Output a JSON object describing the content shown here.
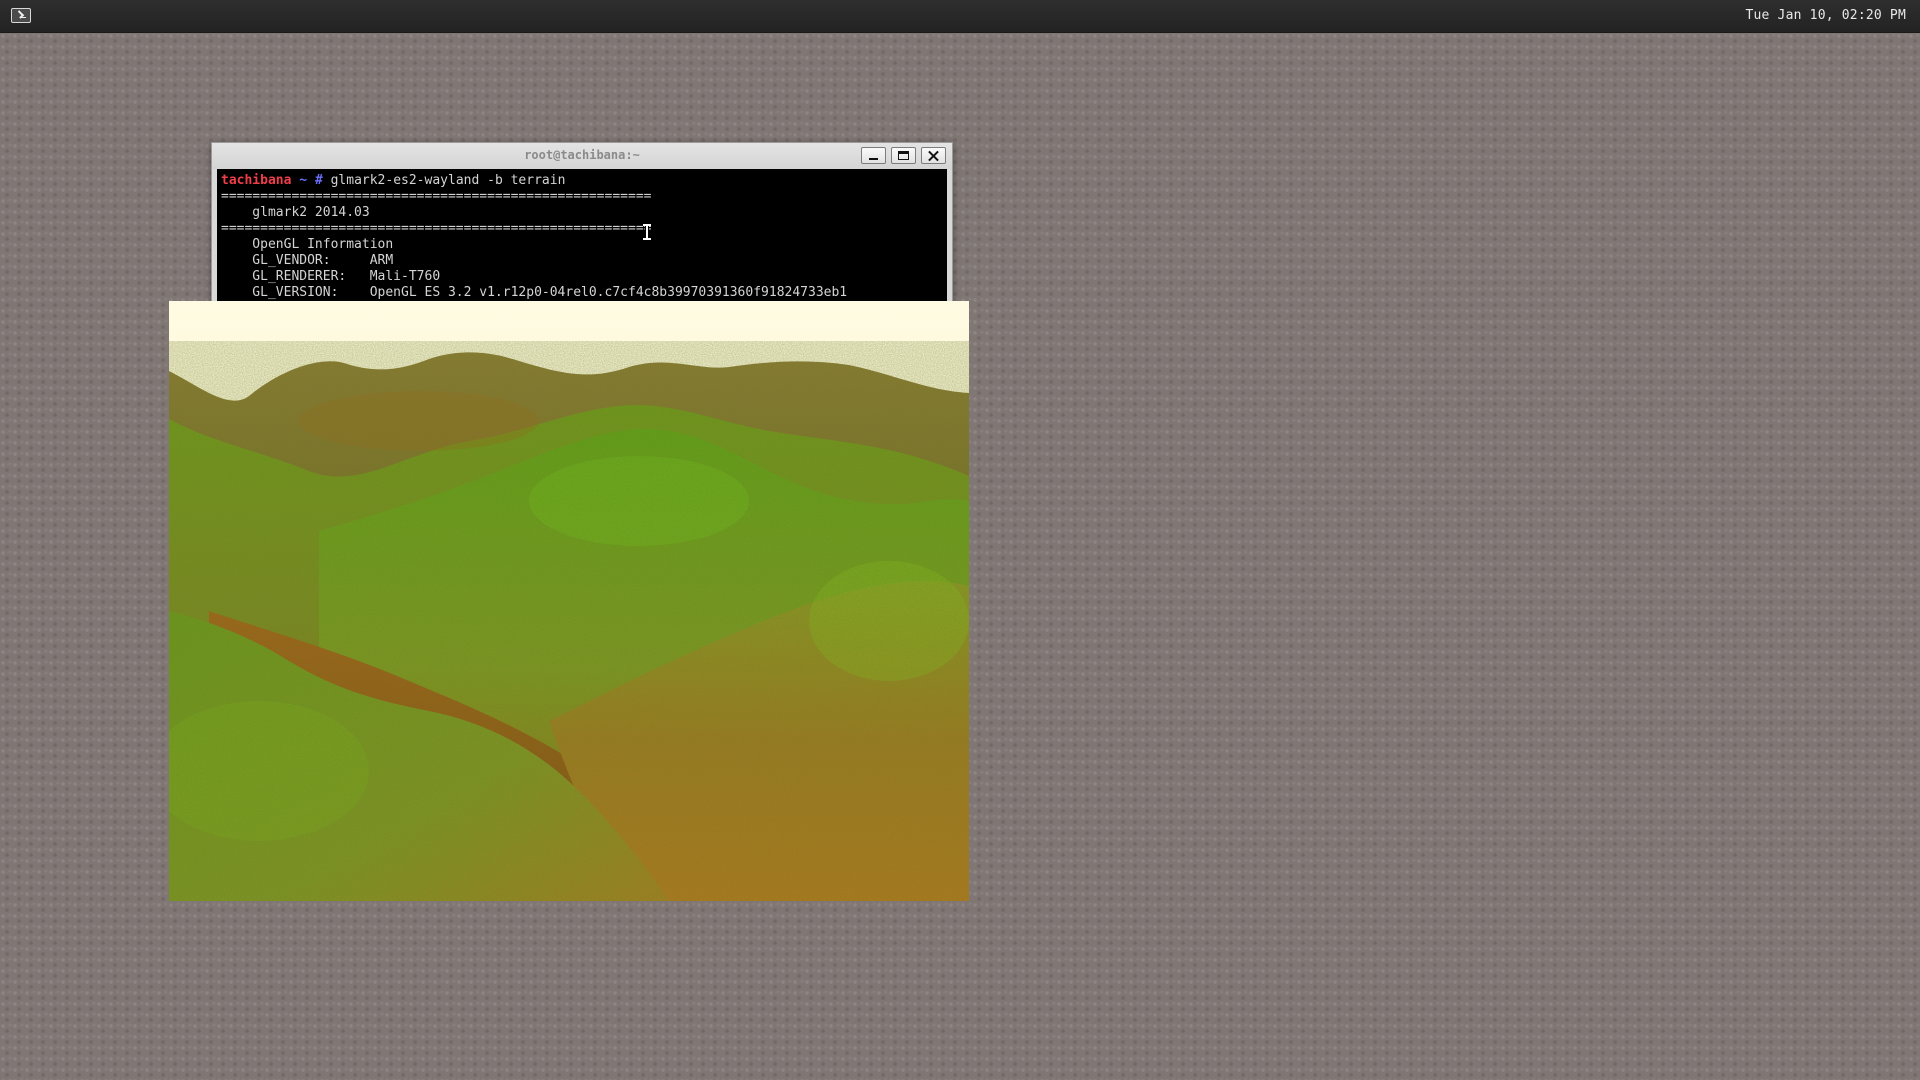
{
  "panel": {
    "launcher_icon": "terminal-icon",
    "clock": "Tue Jan 10, 02:20 PM"
  },
  "terminal": {
    "title": "root@tachibana:~",
    "buttons": {
      "minimize_icon": "minimize-icon",
      "maximize_icon": "maximize-icon",
      "close_icon": "close-icon"
    },
    "prompt": {
      "host": "tachibana",
      "path": "~",
      "symbol": "#",
      "command": "glmark2-es2-wayland -b terrain"
    },
    "lines": [
      "=======================================================",
      "    glmark2 2014.03",
      "=======================================================",
      "    OpenGL Information",
      "    GL_VENDOR:     ARM",
      "    GL_RENDERER:   Mali-T760",
      "    GL_VERSION:    OpenGL ES 3.2 v1.r12p0-04rel0.c7cf4c8b39970391360f91824733eb1"
    ]
  },
  "colors": {
    "prompt_host": "#ef3e4a",
    "prompt_accent": "#6a6ef8",
    "terminal_bg": "#000000",
    "terminal_text": "#d4d4d4",
    "sky": "#fffbe2"
  },
  "terrain_window": {
    "content": "terrain-render"
  }
}
